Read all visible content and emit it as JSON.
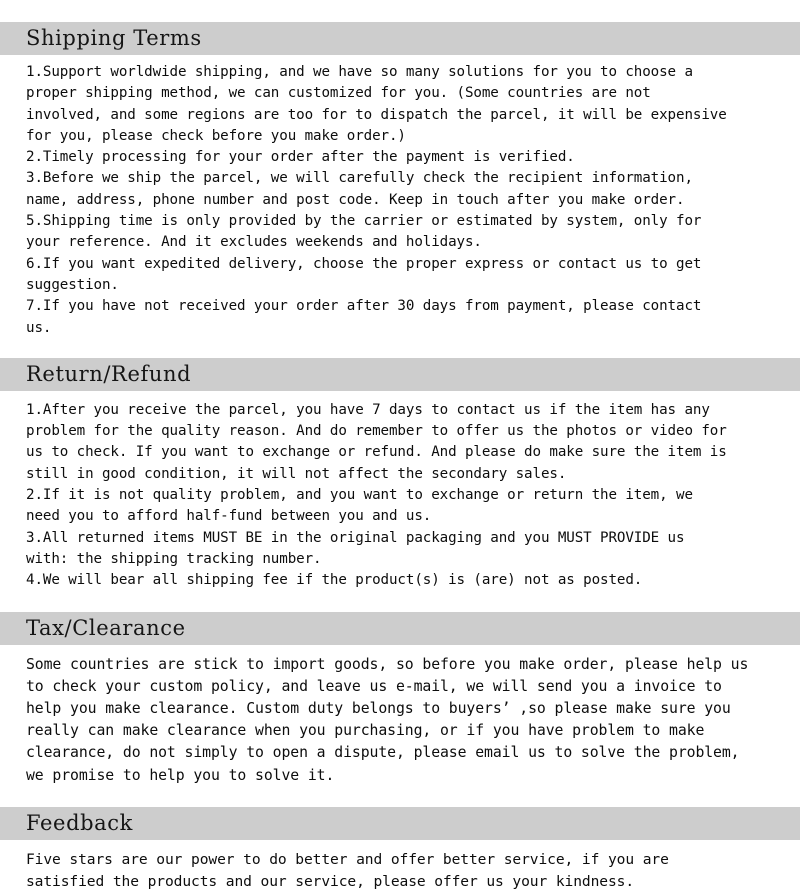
{
  "document": {
    "title": "Shipping & Policy Information",
    "background_color": "#ffffff",
    "header_band_color": "#cdcdcd",
    "text_color": "#000000"
  },
  "sections": [
    {
      "id": "shipping-terms",
      "title": "Shipping Terms",
      "lines": [
        "1.Support worldwide shipping, and we have so many solutions for you to choose a",
        "proper shipping method, we can customized for you. (Some countries are not",
        "involved, and some regions are too for to dispatch the parcel, it will be expensive",
        "for you, please check before you make order.)",
        "2.Timely processing for your order after the payment is verified.",
        "3.Before we ship the parcel, we will carefully check the recipient information,",
        "name, address, phone number and post code. Keep in touch after you make order.",
        "5.Shipping time is only provided by the carrier or estimated by system, only for",
        "your reference. And it excludes weekends and holidays.",
        "6.If you want expedited delivery, choose the proper express or contact us to get",
        "suggestion.",
        "7.If you have not received your order after 30 days from payment, please contact",
        "us."
      ]
    },
    {
      "id": "return-refund",
      "title": "Return/Refund",
      "lines": [
        "1.After you receive the parcel, you have 7 days to contact us if the item has any",
        "problem for the quality reason. And do remember to offer us the photos or video for",
        "us to check. If you want to exchange or refund. And please do make sure the item is",
        "still in good condition, it will not affect the secondary sales.",
        "2.If it is not quality problem, and you want to exchange or return the item, we",
        "need you to afford half-fund between you and us.",
        "3.All returned items MUST BE in the original packaging and you MUST PROVIDE us",
        "with: the shipping tracking number.",
        "4.We will bear all shipping fee if the product(s) is (are) not as posted."
      ]
    },
    {
      "id": "tax-clearance",
      "title": "Tax/Clearance",
      "lines": [
        "Some countries are stick to import goods, so before you make order, please help us",
        "to check your custom policy, and leave us e-mail, we will send you a invoice to",
        "help you make clearance. Custom duty belongs to buyers’ ,so please make sure you",
        "really can make clearance when you purchasing, or if you have problem to make",
        "clearance, do not simply to open a dispute, please email us to solve the problem,",
        "we promise to help you to solve it."
      ]
    },
    {
      "id": "feedback",
      "title": "Feedback",
      "lines": [
        "Five stars are our power to do better and offer better service, if you are",
        "satisfied the products and our service, please offer us your kindness."
      ]
    }
  ]
}
